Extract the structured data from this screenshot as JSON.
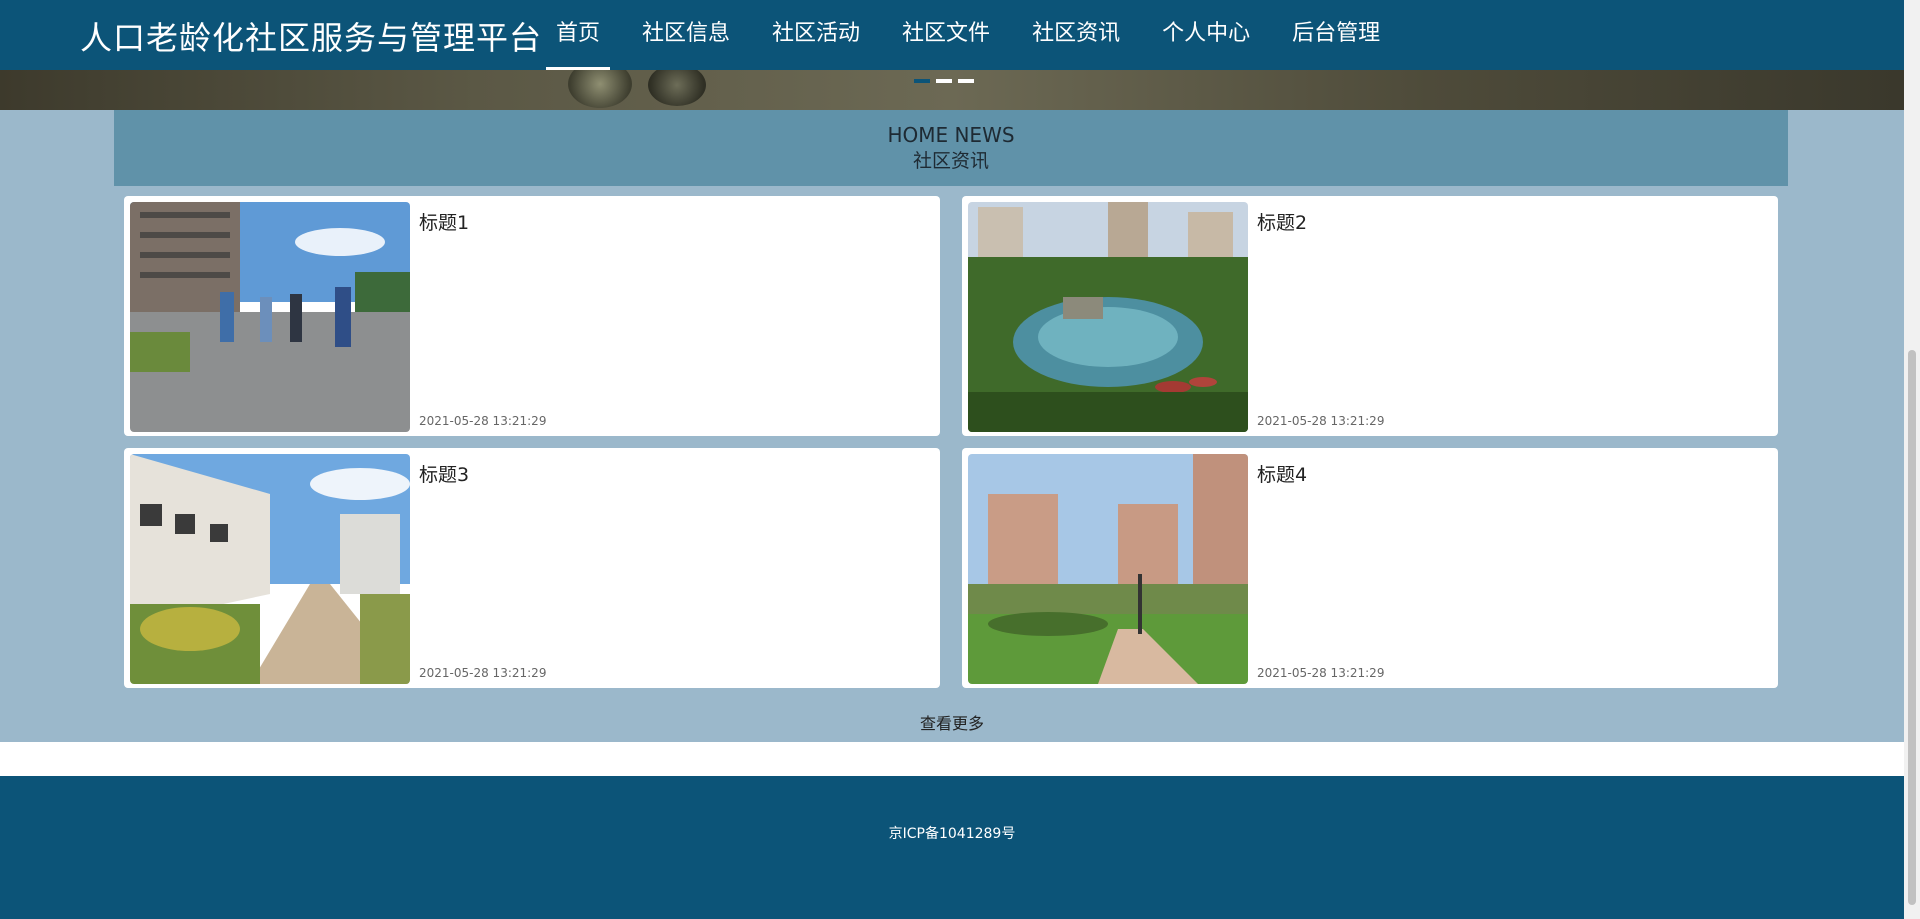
{
  "header": {
    "title": "人口老龄化社区服务与管理平台",
    "nav": [
      "首页",
      "社区信息",
      "社区活动",
      "社区文件",
      "社区资讯",
      "个人中心",
      "后台管理"
    ],
    "active_nav": "首页"
  },
  "banner": {
    "slide_count": 3,
    "active_slide": 1
  },
  "section": {
    "title_en": "HOME NEWS",
    "title_cn": "社区资讯"
  },
  "news": [
    {
      "title": "标题1",
      "date": "2021-05-28 13:21:29"
    },
    {
      "title": "标题2",
      "date": "2021-05-28 13:21:29"
    },
    {
      "title": "标题3",
      "date": "2021-05-28 13:21:29"
    },
    {
      "title": "标题4",
      "date": "2021-05-28 13:21:29"
    }
  ],
  "more_label": "查看更多",
  "footer": {
    "icp": "京ICP备1041289号"
  },
  "colors": {
    "primary": "#0c5478",
    "section_header": "#6092a9",
    "page_bg": "#9bb8cb"
  }
}
